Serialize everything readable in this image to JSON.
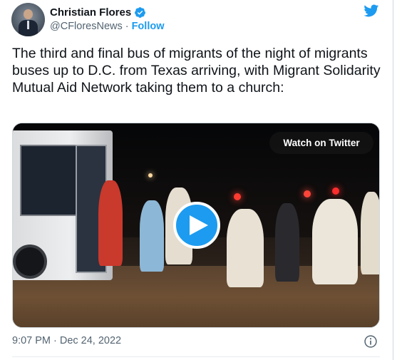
{
  "author": {
    "display_name": "Christian Flores",
    "handle": "@CFloresNews",
    "separator": "·",
    "follow_label": "Follow",
    "verified": true
  },
  "tweet": {
    "text": "The third and final bus of migrants of the night of migrants buses up to D.C. from Texas arriving, with Migrant Solidarity Mutual Aid Network taking them to a church:"
  },
  "media": {
    "watch_label": "Watch on Twitter",
    "play_icon": "play-icon"
  },
  "meta": {
    "time": "9:07 PM",
    "separator": "·",
    "date": "Dec 24, 2022",
    "info_icon": "info-icon"
  },
  "colors": {
    "accent": "#1d9bf0",
    "text": "#0f1419",
    "secondary": "#536471"
  }
}
